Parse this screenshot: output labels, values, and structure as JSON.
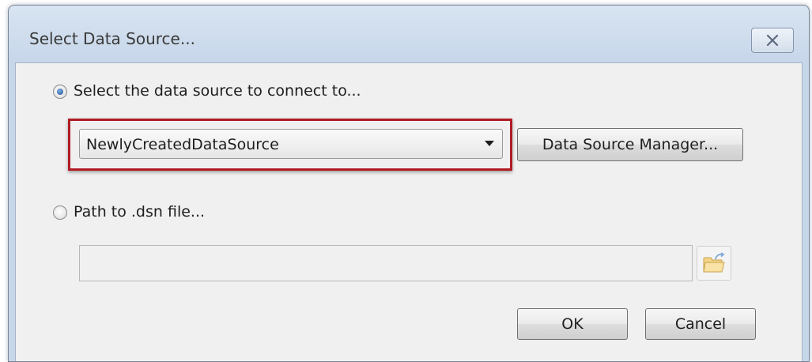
{
  "window": {
    "title": "Select Data Source..."
  },
  "options": {
    "data_source_radio": {
      "label": "Select the data source to connect to...",
      "checked": true
    },
    "dsn_radio": {
      "label": "Path to .dsn file...",
      "checked": false
    }
  },
  "data_source": {
    "selected": "NewlyCreatedDataSource",
    "manager_button_label": "Data Source Manager..."
  },
  "dsn_path": {
    "value": "",
    "placeholder": ""
  },
  "footer": {
    "ok_label": "OK",
    "cancel_label": "Cancel"
  },
  "icons": {
    "close": "close-icon",
    "dropdown": "chevron-down-icon",
    "browse": "folder-icon"
  },
  "colors": {
    "highlight_border": "#b01c24",
    "radio_dot": "#1d4f8f"
  }
}
